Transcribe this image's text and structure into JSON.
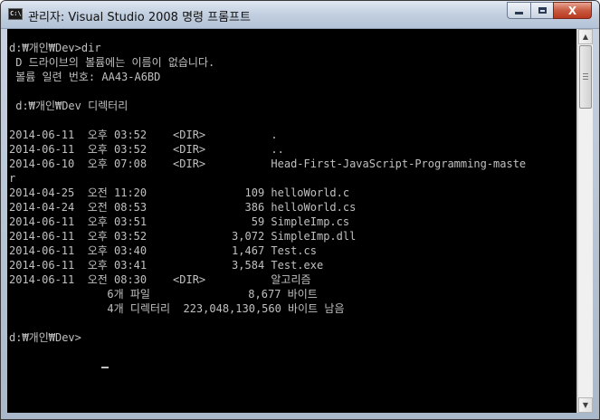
{
  "window": {
    "title": "관리자: Visual Studio 2008 명령 프롬프트",
    "icon_label": "C:\\",
    "icon": "console-icon"
  },
  "controls": {
    "minimize_icon": "minimize-icon",
    "maximize_icon": "maximize-icon",
    "close_label": "X"
  },
  "console": {
    "lines": [
      "d:₩개인₩Dev>dir",
      " D 드라이브의 볼륨에는 이름이 없습니다.",
      " 볼륨 일련 번호: AA43-A6BD",
      "",
      " d:₩개인₩Dev 디렉터리",
      "",
      "2014-06-11  오후 03:52    <DIR>          .",
      "2014-06-11  오후 03:52    <DIR>          ..",
      "2014-06-10  오후 07:08    <DIR>          Head-First-JavaScript-Programming-maste",
      "r",
      "2014-04-25  오전 11:20               109 helloWorld.c",
      "2014-04-24  오전 08:53               386 helloWorld.cs",
      "2014-06-11  오후 03:51                59 SimpleImp.cs",
      "2014-06-11  오후 03:52             3,072 SimpleImp.dll",
      "2014-06-11  오후 03:40             1,467 Test.cs",
      "2014-06-11  오후 03:41             3,584 Test.exe",
      "2014-06-11  오전 08:30    <DIR>          알고리즘",
      "               6개 파일               8,677 바이트",
      "               4개 디렉터리  223,048,130,560 바이트 남음",
      "",
      "d:₩개인₩Dev>"
    ]
  },
  "colors": {
    "console_bg": "#000000",
    "console_fg": "#c0c0c0",
    "close_button": "#c85a40"
  }
}
